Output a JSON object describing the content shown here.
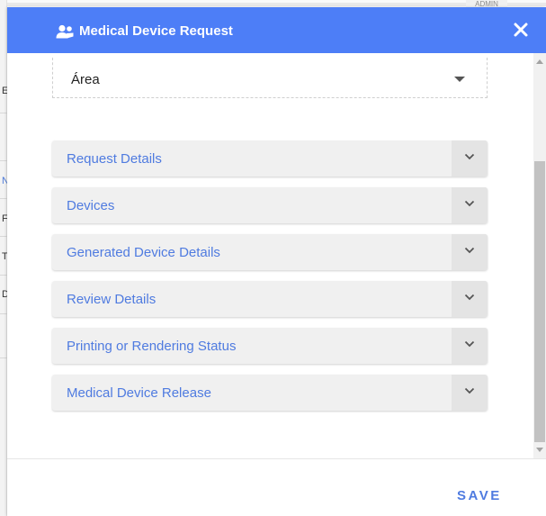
{
  "background": {
    "admin_label": "ADMIN",
    "row_letters": [
      "E",
      "N",
      "F",
      "T",
      "D"
    ]
  },
  "modal": {
    "title": "Medical Device Request",
    "header_icon": "user-group-icon",
    "close_icon": "close-icon",
    "header_color": "#4d7ef7",
    "area_select": {
      "value": "Área",
      "icon": "caret-down-icon"
    },
    "sections": [
      {
        "label": "Request Details",
        "expanded": false
      },
      {
        "label": "Devices",
        "expanded": false
      },
      {
        "label": "Generated Device Details",
        "expanded": false
      },
      {
        "label": "Review Details",
        "expanded": false
      },
      {
        "label": "Printing or Rendering Status",
        "expanded": false
      },
      {
        "label": "Medical Device Release",
        "expanded": false
      }
    ],
    "save_label": "SAVE",
    "accent_color": "#4f7be0"
  }
}
